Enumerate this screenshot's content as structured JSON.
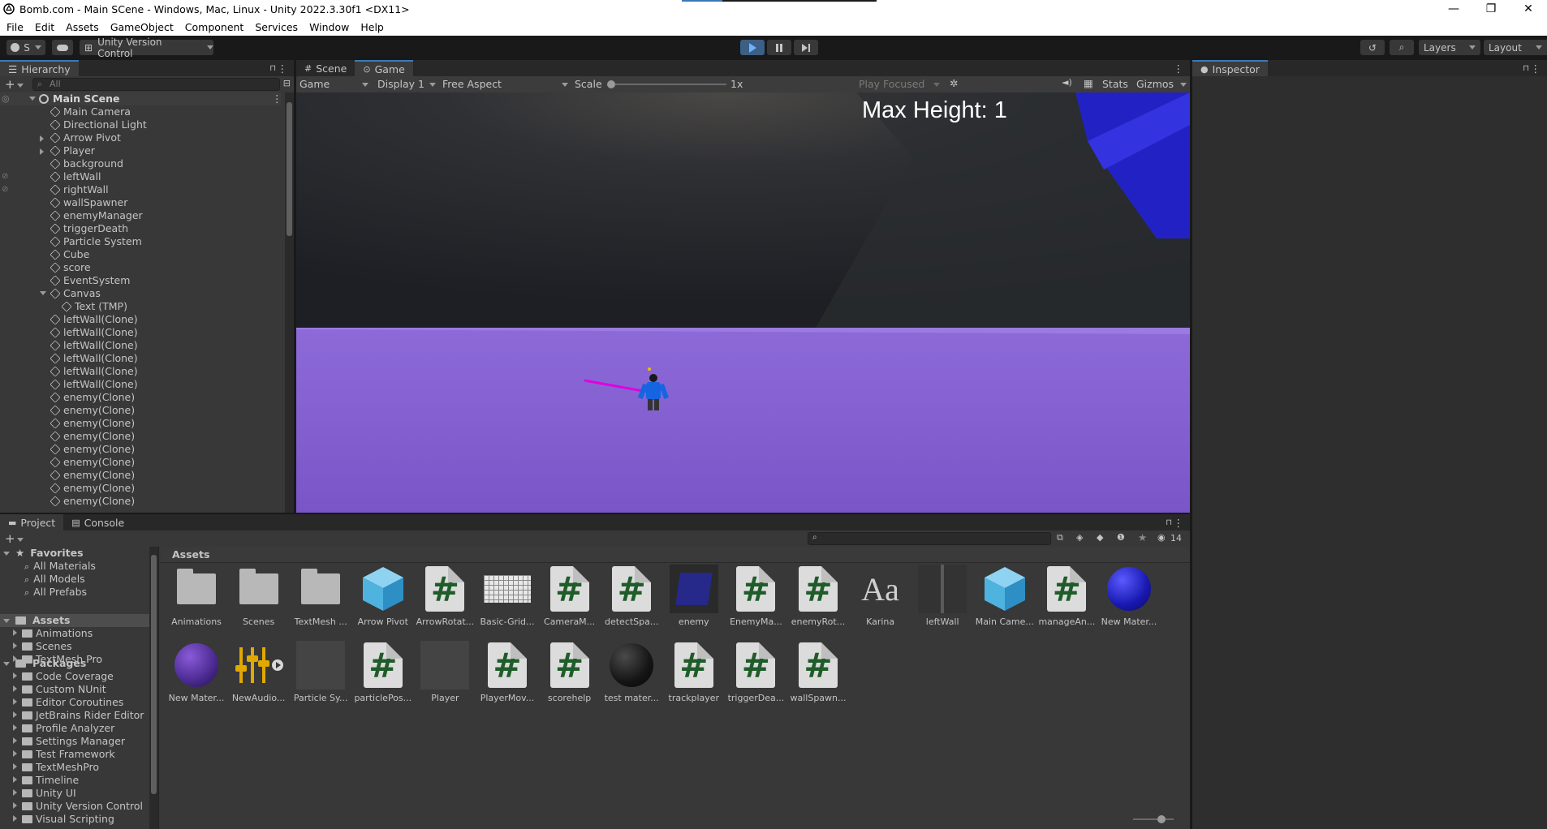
{
  "window": {
    "title": "Bomb.com - Main SCene - Windows, Mac, Linux - Unity 2022.3.30f1 <DX11>",
    "minimize": "—",
    "restore": "❐",
    "close": "✕"
  },
  "menu": [
    "File",
    "Edit",
    "Assets",
    "GameObject",
    "Component",
    "Services",
    "Window",
    "Help"
  ],
  "toolbar": {
    "account": "S",
    "version_control": "Unity Version Control",
    "layers": "Layers",
    "layout": "Layout"
  },
  "hierarchy": {
    "tab": "Hierarchy",
    "search_placeholder": "All",
    "scene": "Main SCene",
    "items": [
      "Main Camera",
      "Directional Light",
      "Arrow Pivot",
      "Player",
      "background",
      "leftWall",
      "rightWall",
      "wallSpawner",
      "enemyManager",
      "triggerDeath",
      "Particle System",
      "Cube",
      "score",
      "EventSystem",
      "Canvas",
      "Text (TMP)",
      "leftWall(Clone)",
      "leftWall(Clone)",
      "leftWall(Clone)",
      "leftWall(Clone)",
      "leftWall(Clone)",
      "leftWall(Clone)",
      "enemy(Clone)",
      "enemy(Clone)",
      "enemy(Clone)",
      "enemy(Clone)",
      "enemy(Clone)",
      "enemy(Clone)",
      "enemy(Clone)",
      "enemy(Clone)",
      "enemy(Clone)"
    ]
  },
  "center": {
    "tabs": [
      "Scene",
      "Game"
    ],
    "game_dropdown": "Game",
    "display": "Display 1",
    "aspect": "Free Aspect",
    "scale_label": "Scale",
    "scale_value": "1x",
    "play_focused": "Play Focused",
    "stats": "Stats",
    "gizmos": "Gizmos",
    "hud_text": "Max Height: 1"
  },
  "inspector": {
    "tab": "Inspector"
  },
  "project": {
    "tabs": [
      "Project",
      "Console"
    ],
    "favorites": {
      "label": "Favorites",
      "items": [
        "All Materials",
        "All Models",
        "All Prefabs"
      ]
    },
    "assets_root": {
      "label": "Assets",
      "items": [
        "Animations",
        "Scenes",
        "TextMesh Pro"
      ]
    },
    "packages": {
      "label": "Packages",
      "items": [
        "Code Coverage",
        "Custom NUnit",
        "Editor Coroutines",
        "JetBrains Rider Editor",
        "Profile Analyzer",
        "Settings Manager",
        "Test Framework",
        "TextMeshPro",
        "Timeline",
        "Unity UI",
        "Unity Version Control",
        "Visual Scripting"
      ]
    },
    "breadcrumb": "Assets",
    "hidden_count": "14",
    "assets_row1": [
      {
        "name": "Animations",
        "kind": "folder"
      },
      {
        "name": "Scenes",
        "kind": "folder"
      },
      {
        "name": "TextMesh ...",
        "kind": "folder"
      },
      {
        "name": "Arrow Pivot",
        "kind": "prefab"
      },
      {
        "name": "ArrowRotat...",
        "kind": "script"
      },
      {
        "name": "Basic-Grid...",
        "kind": "texture"
      },
      {
        "name": "CameraM...",
        "kind": "script"
      },
      {
        "name": "detectSpa...",
        "kind": "script"
      },
      {
        "name": "enemy",
        "kind": "model"
      },
      {
        "name": "EnemyMa...",
        "kind": "script"
      },
      {
        "name": "enemyRot...",
        "kind": "script"
      },
      {
        "name": "Karina",
        "kind": "font"
      },
      {
        "name": "leftWall",
        "kind": "wall"
      },
      {
        "name": "Main Came...",
        "kind": "prefab"
      },
      {
        "name": "manageAn...",
        "kind": "script"
      },
      {
        "name": "New Mater...",
        "kind": "material-blue"
      }
    ],
    "assets_row2": [
      {
        "name": "New Mater...",
        "kind": "material-purple"
      },
      {
        "name": "NewAudio...",
        "kind": "audio"
      },
      {
        "name": "Particle Sy...",
        "kind": "blank"
      },
      {
        "name": "particlePos...",
        "kind": "script"
      },
      {
        "name": "Player",
        "kind": "blank"
      },
      {
        "name": "PlayerMov...",
        "kind": "script"
      },
      {
        "name": "scorehelp",
        "kind": "script"
      },
      {
        "name": "test mater...",
        "kind": "material-black"
      },
      {
        "name": "trackplayer",
        "kind": "script"
      },
      {
        "name": "triggerDea...",
        "kind": "script"
      },
      {
        "name": "wallSpawn...",
        "kind": "script"
      }
    ]
  },
  "icons": {
    "hash": "#",
    "font": "Aa",
    "search": "⌕",
    "plus": "+",
    "more": "⋮",
    "lock": "🔒",
    "star": "★"
  }
}
